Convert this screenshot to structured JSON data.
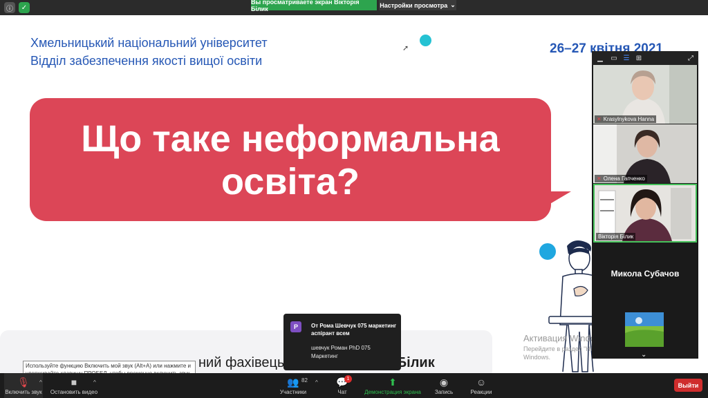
{
  "window": {
    "viewing_banner": "Вы просматриваете экран Вікторія Білик",
    "view_settings_label": "Настройки просмотра",
    "view_settings_caret": "⌄"
  },
  "slide": {
    "university": "Хмельницький національний університет",
    "department": "Відділ забезпечення якості вищої освіти",
    "date": "26–27 квітня 2021",
    "question_line1": "Що таке неформальна",
    "question_line2": "освіта?",
    "speaker_prefix": "ний фахівець відділу ",
    "speaker_name": "Вікторія Білик",
    "activation_title": "Активация Windows",
    "activation_text": "Перейдите в раздел \"Настройки\", чтобы активировать Windows."
  },
  "gallery": {
    "participants": [
      {
        "name": "Krasylnykova Hanna",
        "muted": true
      },
      {
        "name": "Олена Гапченко",
        "muted": true
      },
      {
        "name": "Вікторія Білик",
        "muted": false
      }
    ],
    "name_only": "Микола Субачов"
  },
  "chat_popup": {
    "avatar_letter": "Р",
    "from": "От Рома Шевчук 075 маркетинг аспірант всем",
    "message": "шевчук Роман PhD 075 Маркетинг"
  },
  "tooltip": "Используйте функцию Включить мой звук (Alt+A) или нажмите и удерживайте клавишу ПРОБЕЛ, чтобы временно включить звук.",
  "toolbar": {
    "unmute": "Включить звук",
    "stop_video": "Остановить видео",
    "participants": "Участники",
    "participants_count": "82",
    "chat": "Чат",
    "chat_badge": "1",
    "share": "Демонстрация экрана",
    "record": "Запись",
    "reactions": "Реакции",
    "exit": "Выйти"
  },
  "colors": {
    "bubble": "#dc4657",
    "title_blue": "#2557b5",
    "share_green": "#2fbf4f",
    "exit_red": "#cf2d2d"
  }
}
